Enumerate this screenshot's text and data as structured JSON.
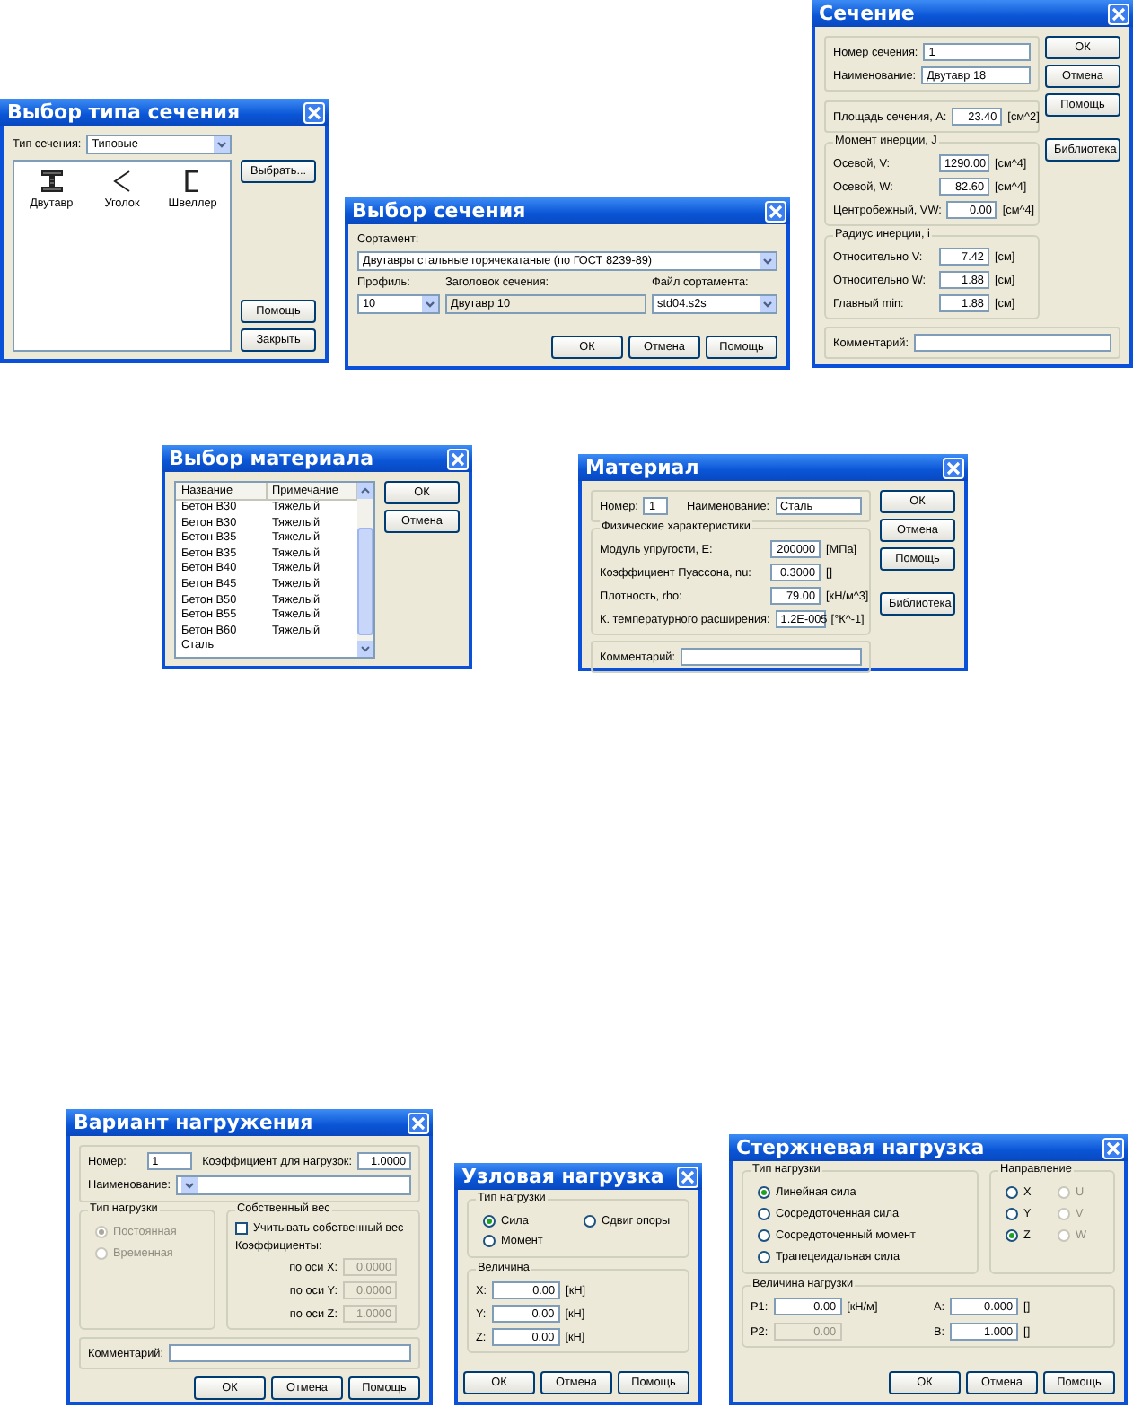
{
  "windows": [
    {
      "kind": "section_type",
      "title": "Выбор типа сечения",
      "type_label": "Тип сечения:",
      "type_value": "Типовые",
      "items": [
        {
          "label": "Двутавр",
          "kind": "i_beam"
        },
        {
          "label": "Уголок",
          "kind": "angle"
        },
        {
          "label": "Швеллер",
          "kind": "channel"
        }
      ],
      "buttons": [
        "Выбрать...",
        "Помощь",
        "Закрыть"
      ]
    },
    {
      "kind": "section_choice",
      "title": "Выбор сечения",
      "assortment_label": "Сортамент:",
      "assortment_value": "Двутавры стальные горячекатаные (по ГОСТ 8239-89)",
      "profile_label": "Профиль:",
      "profile_value": "10",
      "heading_label": "Заголовок сечения:",
      "heading_value": "Двутавр 10",
      "file_label": "Файл сортамента:",
      "file_value": "std04.s2s",
      "buttons": [
        "ОК",
        "Отмена",
        "Помощь"
      ]
    },
    {
      "kind": "section",
      "title": "Сечение",
      "top_fields": [
        {
          "label": "Номер сечения:",
          "value": "1"
        },
        {
          "label": "Наименование:",
          "value": "Двутавр 18"
        }
      ],
      "area": {
        "label": "Площадь сечения, A:",
        "value": "23.40",
        "unit": "[см^2]"
      },
      "groups": [
        {
          "title": "Момент инерции, J",
          "fields": [
            {
              "label": "Осевой, V:",
              "value": "1290.00",
              "unit": "[см^4]"
            },
            {
              "label": "Осевой, W:",
              "value": "82.60",
              "unit": "[см^4]"
            },
            {
              "label": "Центробежный, VW:",
              "value": "0.00",
              "unit": "[см^4]"
            }
          ]
        },
        {
          "title": "Радиус инерции, i",
          "fields": [
            {
              "label": "Относительно V:",
              "value": "7.42",
              "unit": "[см]"
            },
            {
              "label": "Относительно W:",
              "value": "1.88",
              "unit": "[см]"
            },
            {
              "label": "Главный min:",
              "value": "1.88",
              "unit": "[см]"
            }
          ]
        }
      ],
      "comment_label": "Комментарий:",
      "buttons": [
        "ОК",
        "Отмена",
        "Помощь",
        "Библиотека"
      ]
    },
    {
      "kind": "material_choice",
      "title": "Выбор материала",
      "columns": [
        "Название",
        "Примечание"
      ],
      "rows": [
        {
          "name": "Бетон В30",
          "note": "Тяжелый"
        },
        {
          "name": "Бетон В30",
          "note": "Тяжелый"
        },
        {
          "name": "Бетон В35",
          "note": "Тяжелый"
        },
        {
          "name": "Бетон В35",
          "note": "Тяжелый"
        },
        {
          "name": "Бетон В40",
          "note": "Тяжелый"
        },
        {
          "name": "Бетон В45",
          "note": "Тяжелый"
        },
        {
          "name": "Бетон В50",
          "note": "Тяжелый"
        },
        {
          "name": "Бетон В55",
          "note": "Тяжелый"
        },
        {
          "name": "Бетон В60",
          "note": "Тяжелый"
        },
        {
          "name": "Сталь"
        }
      ],
      "buttons": [
        "ОК",
        "Отмена"
      ]
    },
    {
      "kind": "material",
      "title": "Материал",
      "number_label": "Номер:",
      "number": "1",
      "name_label": "Наименование:",
      "name": "Сталь",
      "group": {
        "title": "Физические характеристики",
        "fields": [
          {
            "label": "Модуль упругости, E:",
            "value": "200000",
            "unit": "[МПа]"
          },
          {
            "label": "Коэффициент Пуассона, nu:",
            "value": "0.3000",
            "unit": "[]"
          },
          {
            "label": "Плотность, rho:",
            "value": "79.00",
            "unit": "[кН/м^3]"
          },
          {
            "label": "К. температурного расширения:",
            "value": "1.2E-005",
            "unit": "[°К^-1]"
          }
        ]
      },
      "comment_label": "Комментарий:",
      "buttons": [
        "ОК",
        "Отмена",
        "Помощь",
        "Библиотека"
      ]
    },
    {
      "kind": "load_case",
      "title": "Вариант нагружения",
      "number_label": "Номер:",
      "number": "1",
      "factor_label": "Коэффициент для нагрузок:",
      "factor": "1.0000",
      "name_label": "Наименование:",
      "load_type": {
        "title": "Тип нагрузки",
        "options": [
          {
            "label": "Постоянная",
            "selected": true,
            "disabled": true
          },
          {
            "label": "Временная",
            "selected": false,
            "disabled": true
          }
        ]
      },
      "self_weight": {
        "title": "Собственный вес",
        "check": {
          "label": "Учитывать собственный вес",
          "checked": false
        },
        "coef_label": "Коэффициенты:",
        "coefs": [
          {
            "label": "по оси X:",
            "value": "0.0000",
            "disabled": true
          },
          {
            "label": "по оси Y:",
            "value": "0.0000",
            "disabled": true
          },
          {
            "label": "по оси Z:",
            "value": "1.0000",
            "disabled": true
          }
        ]
      },
      "comment_label": "Комментарий:",
      "buttons": [
        "ОК",
        "Отмена",
        "Помощь"
      ]
    },
    {
      "kind": "node_load",
      "title": "Узловая нагрузка",
      "load_type": {
        "title": "Тип нагрузки",
        "options": [
          {
            "label": "Сила",
            "selected": true
          },
          {
            "label": "Сдвиг опоры",
            "selected": false
          },
          {
            "label": "Момент",
            "selected": false
          }
        ]
      },
      "value": {
        "title": "Величина",
        "fields": [
          {
            "label": "X:",
            "value": "0.00",
            "unit": "[кН]"
          },
          {
            "label": "Y:",
            "value": "0.00",
            "unit": "[кН]"
          },
          {
            "label": "Z:",
            "value": "0.00",
            "unit": "[кН]"
          }
        ]
      },
      "buttons": [
        "ОК",
        "Отмена",
        "Помощь"
      ]
    },
    {
      "kind": "bar_load",
      "title": "Стержневая нагрузка",
      "load_type": {
        "title": "Тип нагрузки",
        "options": [
          {
            "label": "Линейная сила",
            "selected": true
          },
          {
            "label": "Сосредоточенная сила",
            "selected": false
          },
          {
            "label": "Сосредоточенный момент",
            "selected": false
          },
          {
            "label": "Трапецеидальная сила",
            "selected": false
          }
        ]
      },
      "direction": {
        "title": "Направление",
        "options": [
          {
            "label": "X",
            "selected": false,
            "disabled": false
          },
          {
            "label": "U",
            "selected": false,
            "disabled": true
          },
          {
            "label": "Y",
            "selected": false,
            "disabled": false
          },
          {
            "label": "V",
            "selected": false,
            "disabled": true
          },
          {
            "label": "Z",
            "selected": true,
            "disabled": false
          },
          {
            "label": "W",
            "selected": false,
            "disabled": true
          }
        ]
      },
      "value": {
        "title": "Величина нагрузки",
        "fields": [
          {
            "label": "P1:",
            "value": "0.00",
            "unit": "[кН/м]",
            "disabled": false
          },
          {
            "label": "A:",
            "value": "0.000",
            "unit": "[]",
            "disabled": false
          },
          {
            "label": "P2:",
            "value": "0.00",
            "disabled": true
          },
          {
            "label": "B:",
            "value": "1.000",
            "unit": "[]",
            "disabled": false
          }
        ]
      },
      "buttons": [
        "ОК",
        "Отмена",
        "Помощь"
      ]
    }
  ]
}
